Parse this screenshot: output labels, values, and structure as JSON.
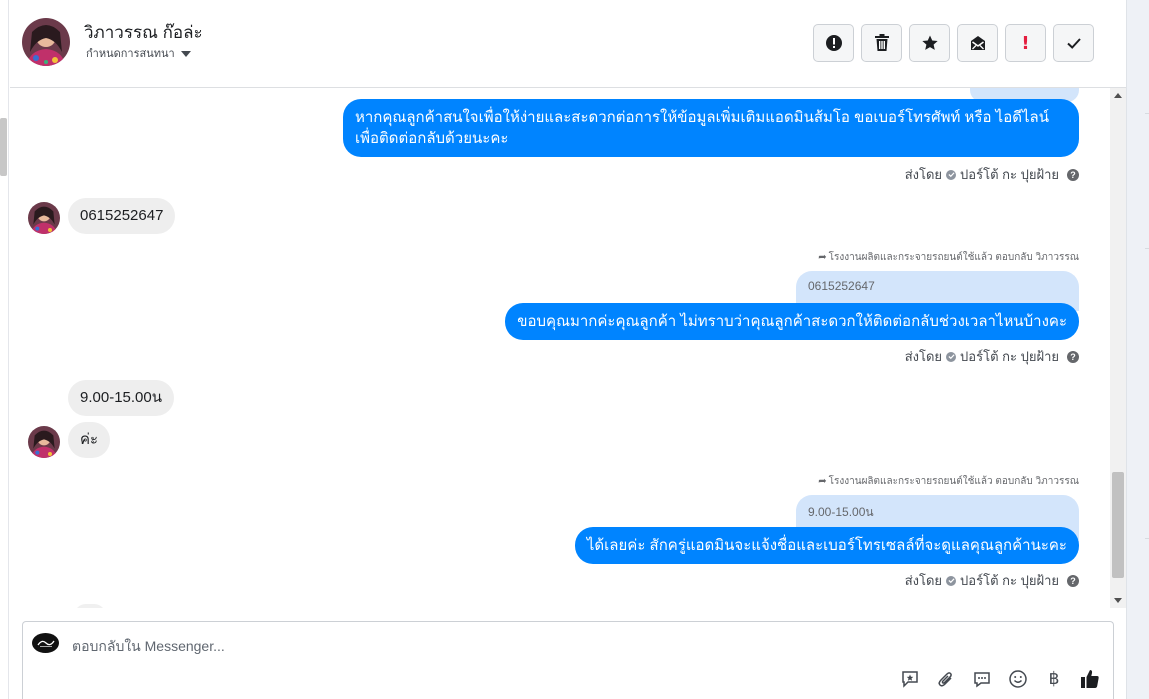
{
  "header": {
    "contact_name": "วิภาวรรณ ก๊อล่ะ",
    "conversation_label": "กำหนดการสนทนา",
    "actions": [
      {
        "name": "report-icon",
        "label": "!"
      },
      {
        "name": "trash-icon",
        "label": ""
      },
      {
        "name": "star-icon",
        "label": ""
      },
      {
        "name": "mark-unread-icon",
        "label": ""
      },
      {
        "name": "important-icon",
        "label": "!"
      },
      {
        "name": "done-check-icon",
        "label": ""
      }
    ]
  },
  "messages": {
    "m1_text_line1": "หากคุณลูกค้าสนใจเพื่อให้ง่ายและสะดวกต่อการให้ข้อมูลเพิ่มเติมแอดมินส้มโอ ขอเบอร์โทรศัพท์ หรือ ไอดีไลน์",
    "m1_text_line2": "เพื่อติดต่อกลับด้วยนะคะ",
    "m2_text": "0615252647",
    "reply_context": "โรงงานผลิตและกระจายรถยนต์ใช้แล้ว ตอบกลับ วิภาวรรณ",
    "m3_quote": "0615252647",
    "m3_text": "ขอบคุณมากค่ะคุณลูกค้า ไม่ทราบว่าคุณลูกค้าสะดวกให้ติดต่อกลับช่วงเวลาไหนบ้างคะ",
    "m4_text": "9.00-15.00น",
    "m5_text": "ค่ะ",
    "m6_quote": "9.00-15.00น",
    "m6_text": "ได้เลยค่ะ สักครู่แอดมินจะแจ้งชื่อและเบอร์โทรเซลล์ที่จะดูแลคุณลูกค้านะคะ",
    "sent_by_prefix": "ส่งโดย",
    "sent_by_name": "ปอร์โต้ กะ ปุยฝ้าย"
  },
  "composer": {
    "placeholder": "ตอบกลับใน Messenger...",
    "tools": [
      "saved-reply-icon",
      "attachment-icon",
      "chat-icon",
      "emoji-icon",
      "baht-icon",
      "thumbs-up-icon"
    ],
    "baht_symbol": "฿"
  },
  "colors": {
    "outgoing": "#0084ff",
    "incoming": "#eeeeee",
    "quote": "#d3e5fb"
  }
}
